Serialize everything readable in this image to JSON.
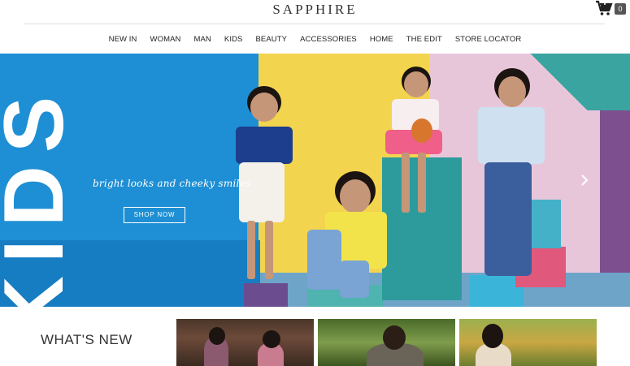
{
  "brand": {
    "logo": "SAPPHIRE"
  },
  "cart": {
    "count": "0",
    "icon": "cart-icon"
  },
  "nav": {
    "items": [
      "NEW IN",
      "WOMAN",
      "MAN",
      "KIDS",
      "BEAUTY",
      "ACCESSORIES",
      "HOME",
      "THE EDIT",
      "STORE LOCATOR"
    ]
  },
  "hero": {
    "big_word": "KIDS",
    "tagline": "bright looks and cheeky smiles",
    "cta": "SHOP NOW",
    "next_icon": "chevron-right-icon",
    "colors": {
      "blue": "#1e8fd4",
      "yellow": "#f3d44f",
      "pink": "#e8c6da",
      "teal": "#2d9b9c"
    }
  },
  "section": {
    "title": "WHAT'S NEW"
  }
}
